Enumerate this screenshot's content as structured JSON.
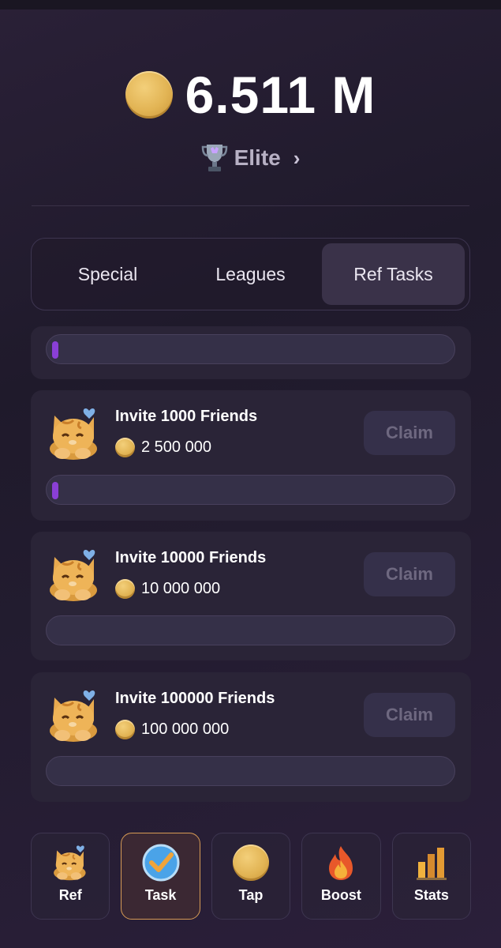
{
  "balance": {
    "value": "6.511 M"
  },
  "league": {
    "name": "Elite",
    "chevron": "›",
    "icon": "trophy-icon"
  },
  "tabs": [
    {
      "label": "Special",
      "active": false
    },
    {
      "label": "Leagues",
      "active": false
    },
    {
      "label": "Ref Tasks",
      "active": true
    }
  ],
  "overall_progress": {
    "fraction": 0.01
  },
  "tasks": [
    {
      "title": "Invite 1000 Friends",
      "reward": "2 500 000",
      "claim_label": "Claim",
      "progress": 0.01
    },
    {
      "title": "Invite 10000 Friends",
      "reward": "10 000 000",
      "claim_label": "Claim",
      "progress": 0.0
    },
    {
      "title": "Invite 100000 Friends",
      "reward": "100 000 000",
      "claim_label": "Claim",
      "progress": 0.0
    }
  ],
  "nav": [
    {
      "label": "Ref",
      "icon": "cat-icon",
      "active": false
    },
    {
      "label": "Task",
      "icon": "checkmark-icon",
      "active": true
    },
    {
      "label": "Tap",
      "icon": "coin-icon",
      "active": false
    },
    {
      "label": "Boost",
      "icon": "fire-icon",
      "active": false
    },
    {
      "label": "Stats",
      "icon": "bar-chart-icon",
      "active": false
    }
  ],
  "colors": {
    "accent": "#8a3fd6",
    "coin": "#e2b454",
    "active_border": "#d79b55"
  }
}
